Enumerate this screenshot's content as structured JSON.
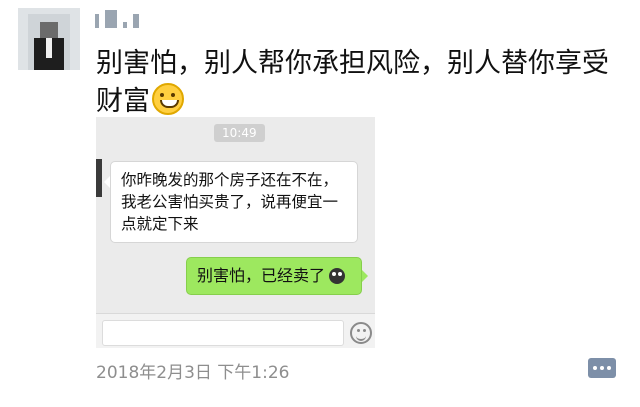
{
  "post": {
    "author_name": "",
    "text": "别害怕，别人帮你承担风险，别人替你享受财富",
    "emoji": "grinning-face",
    "timestamp": "2018年2月3日 下午1:26"
  },
  "chat": {
    "time": "10:49",
    "incoming_message": "你昨晚发的那个房子还在不在，我老公害怕买贵了，说再便宜一点就定下来",
    "outgoing_message": "别害怕，已经卖了",
    "outgoing_emoji": "monkey-face"
  },
  "colors": {
    "outgoing_bubble": "#9de85f",
    "chat_bg": "#ebebeb",
    "timestamp_text": "#8e8e8e",
    "comment_button": "#7d8fa8"
  }
}
